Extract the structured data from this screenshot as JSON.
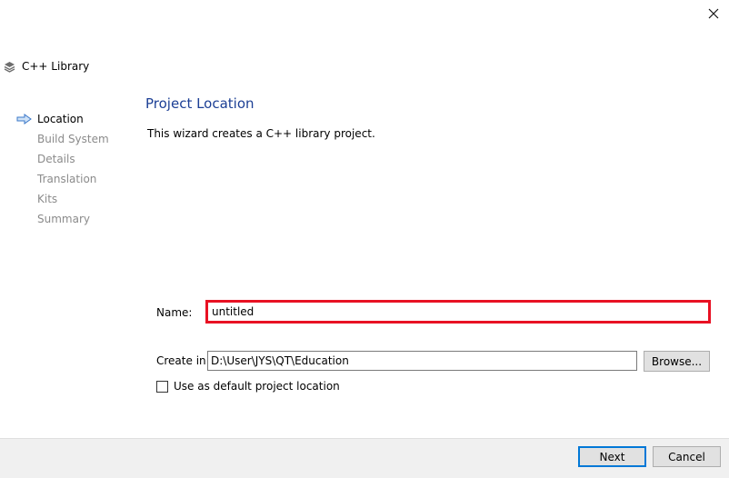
{
  "window": {
    "close_icon": "close-icon",
    "wizard_title": "C++ Library",
    "wizard_icon": "library-stack-icon"
  },
  "steps": [
    {
      "label": "Location",
      "current": true
    },
    {
      "label": "Build System",
      "current": false
    },
    {
      "label": "Details",
      "current": false
    },
    {
      "label": "Translation",
      "current": false
    },
    {
      "label": "Kits",
      "current": false
    },
    {
      "label": "Summary",
      "current": false
    }
  ],
  "page": {
    "title": "Project Location",
    "description": "This wizard creates a C++ library project."
  },
  "form": {
    "name_label": "Name:",
    "name_value": "untitled",
    "create_in_label": "Create in:",
    "create_in_value": "D:\\User\\JYS\\QT\\Education",
    "browse_label": "Browse...",
    "default_location_label": "Use as default project location",
    "default_location_checked": false
  },
  "footer": {
    "next_label": "Next",
    "cancel_label": "Cancel"
  },
  "colors": {
    "title_blue": "#1c3f95",
    "highlight_red": "#e81123",
    "focus_blue": "#0078d7",
    "step_inactive": "#8b8b8b"
  }
}
